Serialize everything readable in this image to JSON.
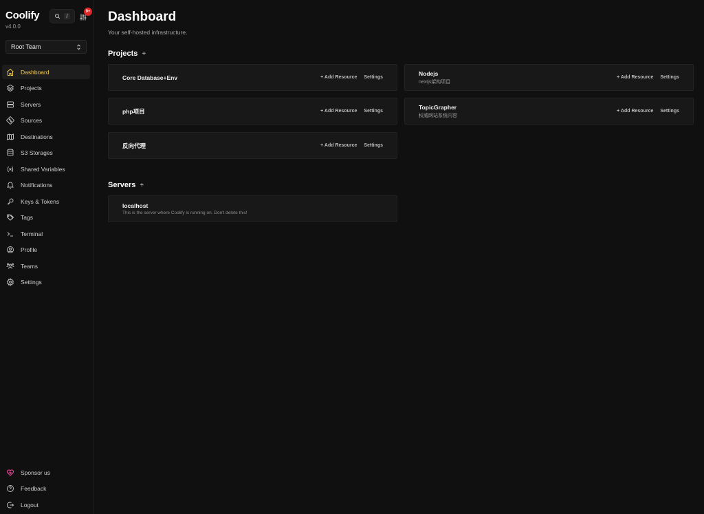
{
  "app": {
    "name": "Coolify",
    "version": "v4.0.0",
    "search_shortcut": "/",
    "notification_badge": "9+"
  },
  "team": {
    "selected": "Root Team"
  },
  "nav": {
    "items": [
      {
        "label": "Dashboard",
        "icon": "home-icon",
        "active": true
      },
      {
        "label": "Projects",
        "icon": "layers-icon"
      },
      {
        "label": "Servers",
        "icon": "server-icon"
      },
      {
        "label": "Sources",
        "icon": "git-icon"
      },
      {
        "label": "Destinations",
        "icon": "map-icon"
      },
      {
        "label": "S3 Storages",
        "icon": "database-icon"
      },
      {
        "label": "Shared Variables",
        "icon": "variable-icon"
      },
      {
        "label": "Notifications",
        "icon": "bell-icon"
      },
      {
        "label": "Keys & Tokens",
        "icon": "key-icon"
      },
      {
        "label": "Tags",
        "icon": "tag-icon"
      },
      {
        "label": "Terminal",
        "icon": "terminal-icon"
      },
      {
        "label": "Profile",
        "icon": "user-icon"
      },
      {
        "label": "Teams",
        "icon": "team-icon"
      },
      {
        "label": "Settings",
        "icon": "gear-icon"
      }
    ],
    "bottom": [
      {
        "label": "Sponsor us",
        "icon": "heart-icon"
      },
      {
        "label": "Feedback",
        "icon": "help-icon"
      },
      {
        "label": "Logout",
        "icon": "logout-icon"
      }
    ]
  },
  "page": {
    "title": "Dashboard",
    "subtitle": "Your self-hosted infrastructure."
  },
  "projects": {
    "title": "Projects",
    "add_label": "+",
    "items": [
      {
        "name": "Core Database+Env",
        "description": "",
        "add_resource": "+ Add Resource",
        "settings": "Settings"
      },
      {
        "name": "Nodejs",
        "description": "nextjs架构项目",
        "add_resource": "+ Add Resource",
        "settings": "Settings"
      },
      {
        "name": "php项目",
        "description": "",
        "add_resource": "+ Add Resource",
        "settings": "Settings"
      },
      {
        "name": "TopicGrapher",
        "description": "权威网站系统内容",
        "add_resource": "+ Add Resource",
        "settings": "Settings"
      },
      {
        "name": "反向代理",
        "description": "",
        "add_resource": "+ Add Resource",
        "settings": "Settings"
      }
    ]
  },
  "servers": {
    "title": "Servers",
    "add_label": "+",
    "items": [
      {
        "name": "localhost",
        "description": "This is the server where Coolify is running on. Don't delete this!"
      }
    ]
  },
  "colors": {
    "background": "#101010",
    "card": "#181818",
    "accent": "#fcd34d",
    "badge": "#dc2626",
    "sponsor": "#ec4899"
  }
}
